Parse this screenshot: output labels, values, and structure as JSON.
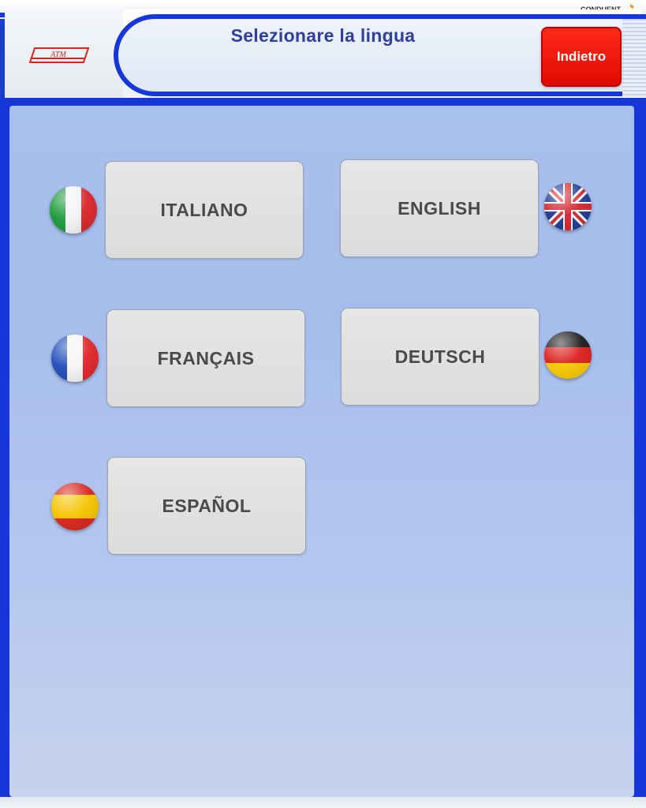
{
  "header": {
    "brand_logo": "ATM",
    "vendor": "CONDUENT",
    "title": "Selezionare la lingua",
    "back_label": "Indietro"
  },
  "languages": [
    {
      "label": "ITALIANO",
      "flag": "italy-flag-icon"
    },
    {
      "label": "ENGLISH",
      "flag": "uk-flag-icon"
    },
    {
      "label": "FRANÇAIS",
      "flag": "france-flag-icon"
    },
    {
      "label": "DEUTSCH",
      "flag": "germany-flag-icon"
    },
    {
      "label": "ESPAÑOL",
      "flag": "spain-flag-icon"
    }
  ],
  "colors": {
    "frame_blue": "#1536d8",
    "title_text": "#2f3f9e",
    "back_button_red": "#ff1a0d",
    "content_bg": "#a9c0ee",
    "button_gray": "#e2e2e2"
  }
}
